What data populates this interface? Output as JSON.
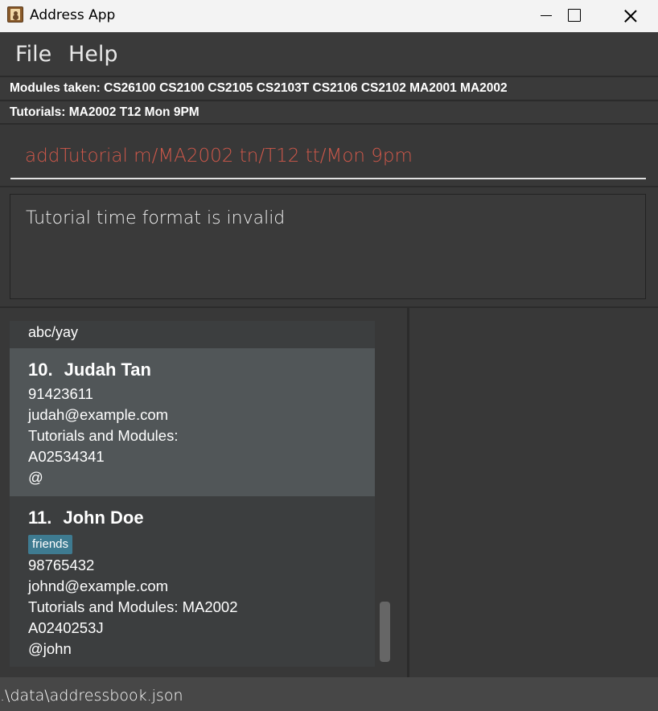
{
  "window": {
    "title": "Address App"
  },
  "menu": {
    "file": "File",
    "help": "Help"
  },
  "modules_bar": "Modules taken: CS26100 CS2100 CS2105 CS2103T CS2106 CS2102 MA2001 MA2002",
  "tutorials_bar": "Tutorials: MA2002 T12 Mon 9PM",
  "command": {
    "value": "addTutorial m/MA2002 tn/T12 tt/Mon 9pm"
  },
  "result": {
    "text": "Tutorial time format is invalid"
  },
  "list": {
    "partial_text": "abc/yay",
    "cards": [
      {
        "index": "10.",
        "name": "Judah Tan",
        "phone": "91423611",
        "email": "judah@example.com",
        "tutorials": "Tutorials and Modules:",
        "student_id": "A02534341",
        "telegram": "@"
      },
      {
        "index": "11.",
        "name": "John Doe",
        "tag": "friends",
        "phone": "98765432",
        "email": "johnd@example.com",
        "tutorials": "Tutorials and Modules: MA2002",
        "student_id": "A0240253J",
        "telegram": "@john"
      }
    ]
  },
  "status": {
    "path": ".\\data\\addressbook.json"
  },
  "colors": {
    "command_text": "#d0584a",
    "tag_bg": "#3e7b91",
    "selected_card": "#515658"
  }
}
